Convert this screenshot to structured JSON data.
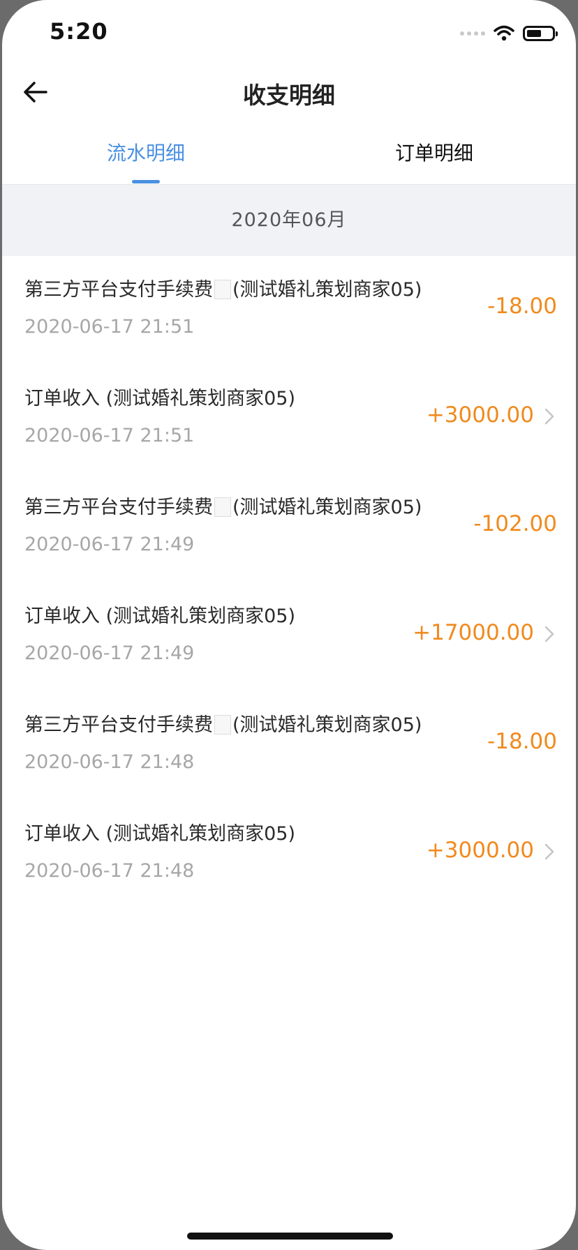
{
  "status_bar": {
    "time": "5:20"
  },
  "header": {
    "title": "收支明细"
  },
  "tabs": [
    {
      "label": "流水明细",
      "active": true
    },
    {
      "label": "订单明细",
      "active": false
    }
  ],
  "month_header": "2020年06月",
  "records": [
    {
      "title_prefix": "第三方平台支付手续费",
      "title_suffix": "(测试婚礼策划商家05)",
      "time": "2020-06-17 21:51",
      "amount": "-18.00",
      "has_chevron": false
    },
    {
      "title_prefix": "订单收入",
      "title_suffix": " (测试婚礼策划商家05)",
      "time": "2020-06-17 21:51",
      "amount": "+3000.00",
      "has_chevron": true
    },
    {
      "title_prefix": "第三方平台支付手续费",
      "title_suffix": "(测试婚礼策划商家05)",
      "time": "2020-06-17 21:49",
      "amount": "-102.00",
      "has_chevron": false
    },
    {
      "title_prefix": "订单收入",
      "title_suffix": " (测试婚礼策划商家05)",
      "time": "2020-06-17 21:49",
      "amount": "+17000.00",
      "has_chevron": true
    },
    {
      "title_prefix": "第三方平台支付手续费",
      "title_suffix": "(测试婚礼策划商家05)",
      "time": "2020-06-17 21:48",
      "amount": "-18.00",
      "has_chevron": false
    },
    {
      "title_prefix": "订单收入",
      "title_suffix": " (测试婚礼策划商家05)",
      "time": "2020-06-17 21:48",
      "amount": "+3000.00",
      "has_chevron": true
    }
  ],
  "colors": {
    "accent": "#4a90e2",
    "amount": "#f08a1d",
    "secondary_text": "#a7a7a7",
    "month_bg": "#f0f2f6"
  }
}
